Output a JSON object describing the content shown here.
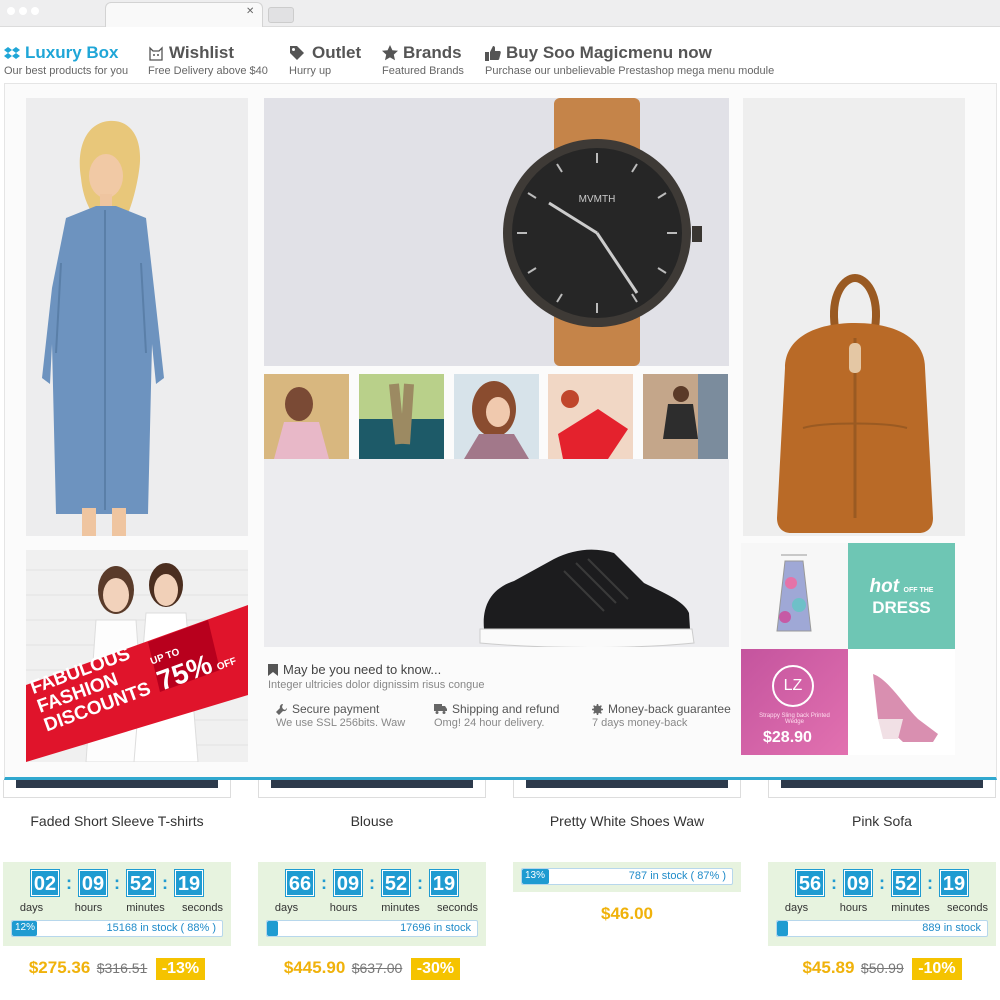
{
  "colors": {
    "accent": "#1fa6d7",
    "price": "#f0b20b",
    "badge": "#f5c300",
    "countdown_bg": "#e7f3df"
  },
  "nav": [
    {
      "title": "Luxury Box",
      "subtitle": "Our best products for you",
      "icon": "dropbox-icon"
    },
    {
      "title": "Wishlist",
      "subtitle": "Free Delivery above $40",
      "icon": "cat-icon"
    },
    {
      "title": "Outlet",
      "subtitle": "Hurry up",
      "icon": "tags-icon"
    },
    {
      "title": "Brands",
      "subtitle": "Featured Brands",
      "icon": "star-icon"
    },
    {
      "title": "Buy Soo Magicmenu now",
      "subtitle": "Purchase our unbelievable Prestashop mega menu module",
      "icon": "thumbs-up-icon"
    }
  ],
  "mega": {
    "promo_banner": {
      "line1": "FABULOUS",
      "line2": "FASHION",
      "line3": "DISCOUNTS",
      "upto": "UP TO",
      "percent": "75%",
      "off": "OFF"
    },
    "watch_brand": "MVMTH",
    "info": {
      "title": "May be you need to know...",
      "subtitle": "Integer ultricies dolor dignissim risus congue"
    },
    "features": [
      {
        "title": "Secure payment",
        "subtitle": "We use SSL 256bits. Waw",
        "icon": "wrench-icon"
      },
      {
        "title": "Shipping and refund",
        "subtitle": "Omg! 24 hour delivery.",
        "icon": "truck-icon"
      },
      {
        "title": "Money-back guarantee",
        "subtitle": "7 days money-back",
        "icon": "cog-icon"
      }
    ],
    "tiles": {
      "hot": "hot",
      "off_the": "OFF THE",
      "dress": "DRESS",
      "lz": "LZ",
      "wedge_caption": "Strappy Sling back Printed Wedge",
      "wedge_price": "$28.90"
    }
  },
  "labels": {
    "days": "days",
    "hours": "hours",
    "minutes": "minutes",
    "seconds": "seconds"
  },
  "products": [
    {
      "name": "Faded Short Sleeve T-shirts",
      "countdown": {
        "d": "02",
        "h": "09",
        "m": "52",
        "s": "19"
      },
      "stock_pct": "12%",
      "stock_pct_value": 0.12,
      "stock_text": "15168 in stock ( 88% )",
      "price": "$275.36",
      "old_price": "$316.51",
      "discount": "-13%"
    },
    {
      "name": "Blouse",
      "countdown": {
        "d": "66",
        "h": "09",
        "m": "52",
        "s": "19"
      },
      "stock_pct": "",
      "stock_pct_value": 0.05,
      "stock_text": "17696 in stock",
      "price": "$445.90",
      "old_price": "$637.00",
      "discount": "-30%"
    },
    {
      "name": "Pretty White Shoes Waw",
      "stock_pct": "13%",
      "stock_pct_value": 0.13,
      "stock_text": "787 in stock ( 87% )",
      "price": "$46.00"
    },
    {
      "name": "Pink Sofa",
      "countdown": {
        "d": "56",
        "h": "09",
        "m": "52",
        "s": "19"
      },
      "stock_pct": "",
      "stock_pct_value": 0.05,
      "stock_text": "889 in stock",
      "price": "$45.89",
      "old_price": "$50.99",
      "discount": "-10%"
    }
  ]
}
